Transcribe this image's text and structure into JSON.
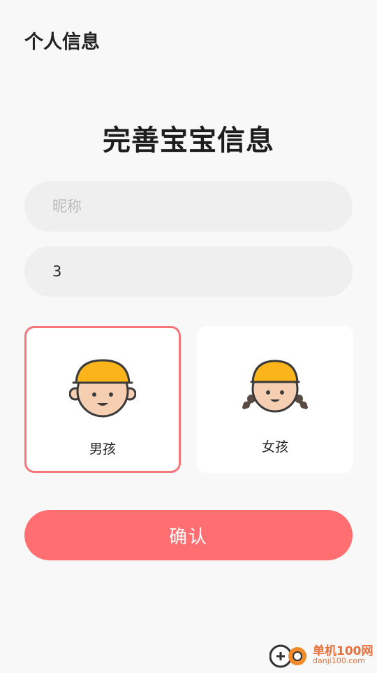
{
  "header": {
    "title": "个人信息"
  },
  "main": {
    "title": "完善宝宝信息",
    "nickname": {
      "value": "",
      "placeholder": "昵称"
    },
    "age": {
      "value": "3",
      "placeholder": ""
    },
    "genders": [
      {
        "label": "男孩",
        "icon": "boy-avatar-icon",
        "selected": true
      },
      {
        "label": "女孩",
        "icon": "girl-avatar-icon",
        "selected": false
      }
    ],
    "confirm_label": "确认"
  },
  "watermark": {
    "name": "单机100网",
    "url": "danji100.com"
  },
  "colors": {
    "accent": "#ff6e70",
    "selected_border": "#f3767a",
    "helmet": "#fbb419",
    "skin": "#f6cfb3",
    "background": "#f8f8f8",
    "field_bg": "#efefef"
  }
}
